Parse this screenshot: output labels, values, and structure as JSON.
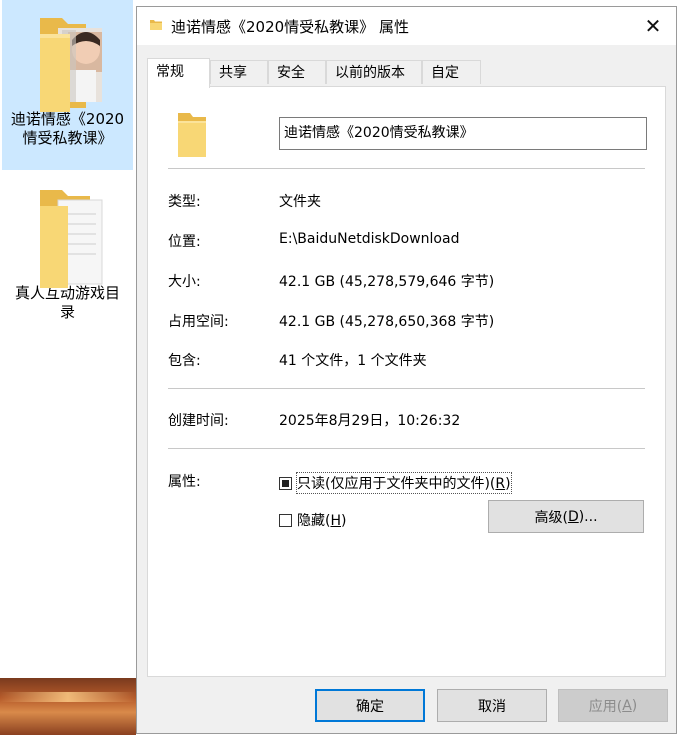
{
  "desktop": {
    "items": [
      {
        "label_line1": "迪诺情感《2020",
        "label_line2": "情受私教课》",
        "selected": true
      },
      {
        "label_line1": "真人互动游戏目",
        "label_line2": "录",
        "selected": false
      }
    ]
  },
  "dialog": {
    "title": "迪诺情感《2020情受私教课》 属性",
    "close_glyph": "✕",
    "tabs": [
      "常规",
      "共享",
      "安全",
      "以前的版本",
      "自定义"
    ],
    "active_tab": "常规",
    "folder_name": "迪诺情感《2020情受私教课》",
    "properties": {
      "type_label": "类型:",
      "type_value": "文件夹",
      "location_label": "位置:",
      "location_value": "E:\\BaiduNetdiskDownload",
      "size_label": "大小:",
      "size_value": "42.1 GB (45,278,579,646 字节)",
      "disk_label": "占用空间:",
      "disk_value": "42.1 GB (45,278,650,368 字节)",
      "contains_label": "包含:",
      "contains_value": "41 个文件，1 个文件夹",
      "created_label": "创建时间:",
      "created_value": "2025年8月29日，10:26:32",
      "attributes_label": "属性:"
    },
    "attributes": {
      "readonly_text": "只读(仅应用于文件夹中的文件)(",
      "readonly_key": "R",
      "readonly_end": ")",
      "readonly_state": "indeterminate",
      "hidden_text": "隐藏(",
      "hidden_key": "H",
      "hidden_end": ")",
      "hidden_state": "unchecked",
      "advanced_text": "高级(",
      "advanced_key": "D",
      "advanced_end": ")..."
    },
    "buttons": {
      "ok": "确定",
      "cancel": "取消",
      "apply_text": "应用(",
      "apply_key": "A",
      "apply_end": ")"
    }
  },
  "colors": {
    "folder_yellow": "#f8d775",
    "folder_dark": "#e9b94a",
    "selection": "#cce8ff",
    "accent": "#0078d7"
  }
}
